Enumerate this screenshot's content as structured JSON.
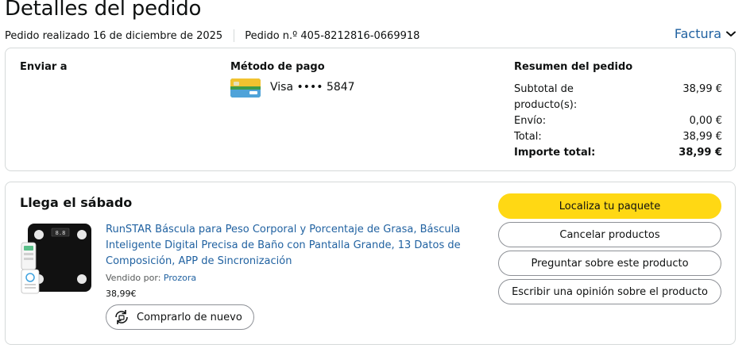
{
  "page": {
    "title": "Detalles del pedido",
    "order_date": "Pedido realizado 16 de diciembre de 2025",
    "order_number": "Pedido n.º 405-8212816-0669918",
    "invoice_label": "Factura"
  },
  "summary_card": {
    "ship_to_heading": "Enviar a",
    "payment_heading": "Método de pago",
    "payment_card": "Visa •••• 5847",
    "summary_heading": "Resumen del pedido",
    "rows": [
      {
        "label": "Subtotal de producto(s):",
        "value": "38,99 €"
      },
      {
        "label": "Envío:",
        "value": "0,00 €"
      },
      {
        "label": "Total:",
        "value": "38,99 €"
      },
      {
        "label": "Importe total:",
        "value": "38,99 €"
      }
    ]
  },
  "shipment": {
    "delivery_status": "Llega el sábado",
    "product": {
      "title": "RunSTAR Báscula para Peso Corporal y Porcentaje de Grasa, Báscula Inteligente Digital Precisa de Baño con Pantalla Grande, 13 Datos de Composición, APP de Sincronización",
      "sold_by_label": "Vendido por:",
      "seller": "Prozora",
      "price": "38,99€",
      "buy_again_label": "Comprarlo de nuevo"
    },
    "actions": {
      "track": "Localiza tu paquete",
      "cancel": "Cancelar productos",
      "ask": "Preguntar sobre este producto",
      "review": "Escribir una opinión sobre el producto"
    }
  },
  "colors": {
    "link": "#2162a1",
    "primary_button": "#ffd814",
    "border": "#d5d9d9"
  }
}
